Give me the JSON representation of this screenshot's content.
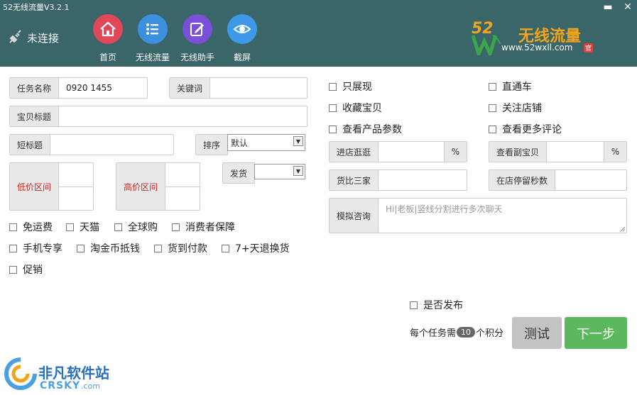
{
  "window": {
    "title": "52无线流量V3.2.1",
    "minimize_label": "▬",
    "close_label": "✕"
  },
  "header": {
    "status": "未连接",
    "nav": [
      {
        "label": "首页",
        "icon": "home-icon",
        "color": "#e0485a"
      },
      {
        "label": "无线流量",
        "icon": "list-icon",
        "color": "#3d8fe0"
      },
      {
        "label": "无线助手",
        "icon": "edit-icon",
        "color": "#7b4fd6"
      },
      {
        "label": "截屏",
        "icon": "eye-icon",
        "color": "#3d9ae8"
      }
    ],
    "brand": {
      "num": "52",
      "name": "无线流量",
      "url": "www.52wxll.com",
      "tag": "官"
    }
  },
  "form": {
    "task_name_label": "任务名称",
    "task_name_value": "0920 1455",
    "keyword_label": "关键词",
    "keyword_value": "",
    "item_title_label": "宝贝标题",
    "short_title_label": "短标题",
    "sort_label": "排序",
    "sort_value": "默认",
    "low_price_label": "低价区间",
    "high_price_label": "高价区间",
    "ship_label": "发货",
    "ship_value": "",
    "checks_left": [
      [
        "免运费",
        "天猫",
        "全球购",
        "消费者保障"
      ],
      [
        "手机专享",
        "淘金币抵钱",
        "货到付款",
        "7+天退换货"
      ],
      [
        "促销"
      ]
    ],
    "checks_right": [
      "只展现",
      "直通车",
      "收藏宝贝",
      "关注店铺",
      "查看产品参数",
      "查看更多评论"
    ],
    "browse_shop_label": "进店逛逛",
    "view_sub_label": "查看副宝贝",
    "percent": "%",
    "compare_label": "货比三家",
    "stay_label": "在店停留秒数",
    "consult_label": "模拟咨询",
    "consult_placeholder": "Hi|老板|竖线分割进行多次聊天",
    "publish_label": "是否发布",
    "cost_prefix": "每个任务需",
    "cost_value": "10",
    "cost_suffix": "个积分",
    "test_button": "测试",
    "next_button": "下一步"
  },
  "watermark": {
    "cn": "非凡软件站",
    "en": "CRSKY",
    "tld": ".com"
  }
}
